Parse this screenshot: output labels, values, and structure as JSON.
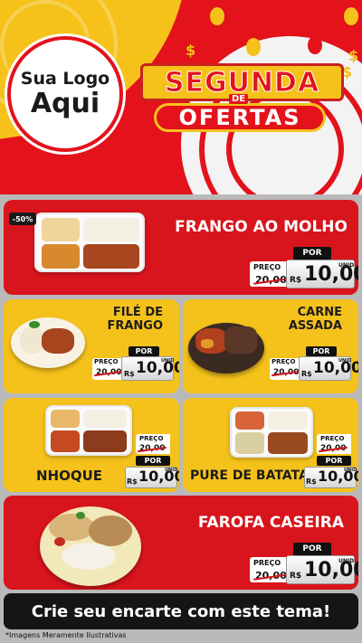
{
  "header": {
    "logo_line1": "Sua Logo",
    "logo_line2": "Aqui",
    "title_top": "SEGUNDA",
    "title_de": "DE",
    "title_bottom": "OFERTAS"
  },
  "colors": {
    "red": "#e3121b",
    "yellow": "#f5c21b",
    "dark": "#151515",
    "white": "#ffffff"
  },
  "price_labels": {
    "preco": "PREÇO",
    "por": "POR",
    "currency": "R$",
    "unit": "UNID"
  },
  "products": [
    {
      "name": "FRANGO AO MOLHO",
      "discount": "-50%",
      "old_price": "20,00",
      "price": "10,00"
    },
    {
      "name_line1": "FILÉ DE",
      "name_line2": "FRANGO",
      "old_price": "20,00",
      "price": "10,00"
    },
    {
      "name_line1": "CARNE",
      "name_line2": "ASSADA",
      "old_price": "20,00",
      "price": "10,00"
    },
    {
      "name": "NHOQUE",
      "old_price": "20,00",
      "price": "10,00"
    },
    {
      "name": "PURE DE BATATA",
      "old_price": "20,00",
      "price": "10,00"
    },
    {
      "name": "FAROFA CASEIRA",
      "old_price": "20,00",
      "price": "10,00"
    }
  ],
  "footer": {
    "cta": "Crie seu encarte com este tema!",
    "disclaimer": "*Imagens Meramente Ilustrativas"
  }
}
